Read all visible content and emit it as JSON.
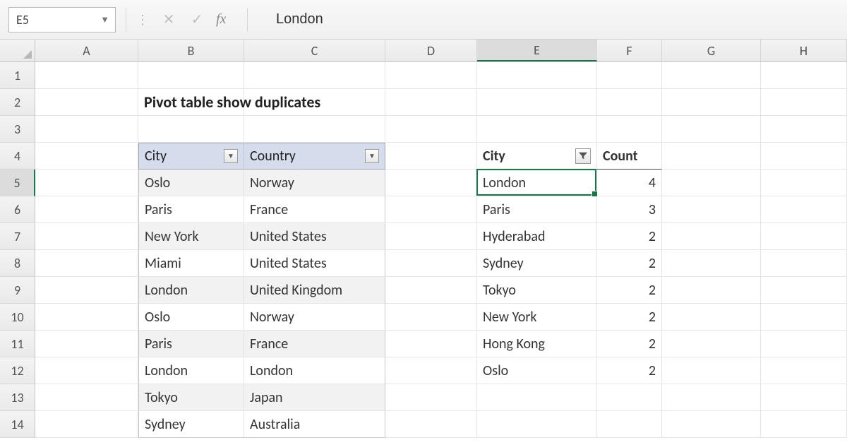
{
  "formula_bar": {
    "cell_ref": "E5",
    "formula_value": "London",
    "fx_label": "fx"
  },
  "columns": [
    "A",
    "B",
    "C",
    "D",
    "E",
    "F",
    "G",
    "H"
  ],
  "active_column": "E",
  "row_numbers": [
    "1",
    "2",
    "3",
    "4",
    "5",
    "6",
    "7",
    "8",
    "9",
    "10",
    "11",
    "12",
    "13",
    "14"
  ],
  "active_row": "5",
  "title": "Pivot table show duplicates",
  "data_table": {
    "headers": {
      "city": "City",
      "country": "Country"
    },
    "rows": [
      {
        "city": "Oslo",
        "country": "Norway"
      },
      {
        "city": "Paris",
        "country": "France"
      },
      {
        "city": "New York",
        "country": "United States"
      },
      {
        "city": "Miami",
        "country": "United States"
      },
      {
        "city": "London",
        "country": "United Kingdom"
      },
      {
        "city": "Oslo",
        "country": "Norway"
      },
      {
        "city": "Paris",
        "country": "France"
      },
      {
        "city": "London",
        "country": "London"
      },
      {
        "city": "Tokyo",
        "country": "Japan"
      },
      {
        "city": "Sydney",
        "country": "Australia"
      }
    ]
  },
  "pivot": {
    "headers": {
      "city": "City",
      "count": "Count"
    },
    "rows": [
      {
        "city": "London",
        "count": "4"
      },
      {
        "city": "Paris",
        "count": "3"
      },
      {
        "city": "Hyderabad",
        "count": "2"
      },
      {
        "city": "Sydney",
        "count": "2"
      },
      {
        "city": "Tokyo",
        "count": "2"
      },
      {
        "city": "New York",
        "count": "2"
      },
      {
        "city": "Hong Kong",
        "count": "2"
      },
      {
        "city": "Oslo",
        "count": "2"
      }
    ]
  }
}
